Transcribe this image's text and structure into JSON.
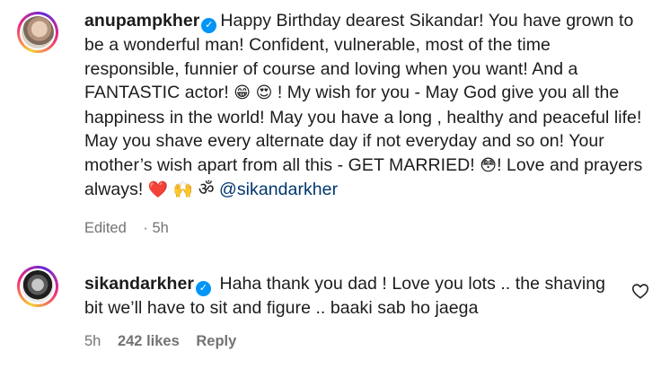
{
  "comments": [
    {
      "username": "anupampkher",
      "text_before": "Happy Birthday dearest Sikandar! You have grown to be a wonderful man! Confident, vulnerable, most of the time responsible, funnier of course and loving when you want! And a FANTASTIC actor! ",
      "emoji_1": "😁",
      "emoji_2": "😍",
      "text_mid": " ! My wish for you - May God give you all the happiness in the world! May you have a long , healthy and peaceful life! May you shave every alternate day if not everyday and so on! Your mother’s wish apart from all this - GET MARRIED! ",
      "emoji_3": "😳",
      "text_after": "! Love and prayers always! ",
      "emoji_4": "❤️",
      "emoji_5": "🙌",
      "emoji_6": "ॐ",
      "mention": "@sikandarkher",
      "edited": "Edited",
      "time": "5h"
    },
    {
      "username": "sikandarkher",
      "text": "Haha thank you dad ! Love you lots .. the shaving bit we’ll have to sit and figure .. baaki sab ho jaega",
      "time": "5h",
      "likes": "242 likes",
      "reply": "Reply"
    }
  ],
  "icons": {
    "verified": "verified-badge-icon",
    "like": "heart-outline-icon"
  },
  "colors": {
    "verified": "#0095f6",
    "mention": "#00376b",
    "meta": "#737373"
  }
}
